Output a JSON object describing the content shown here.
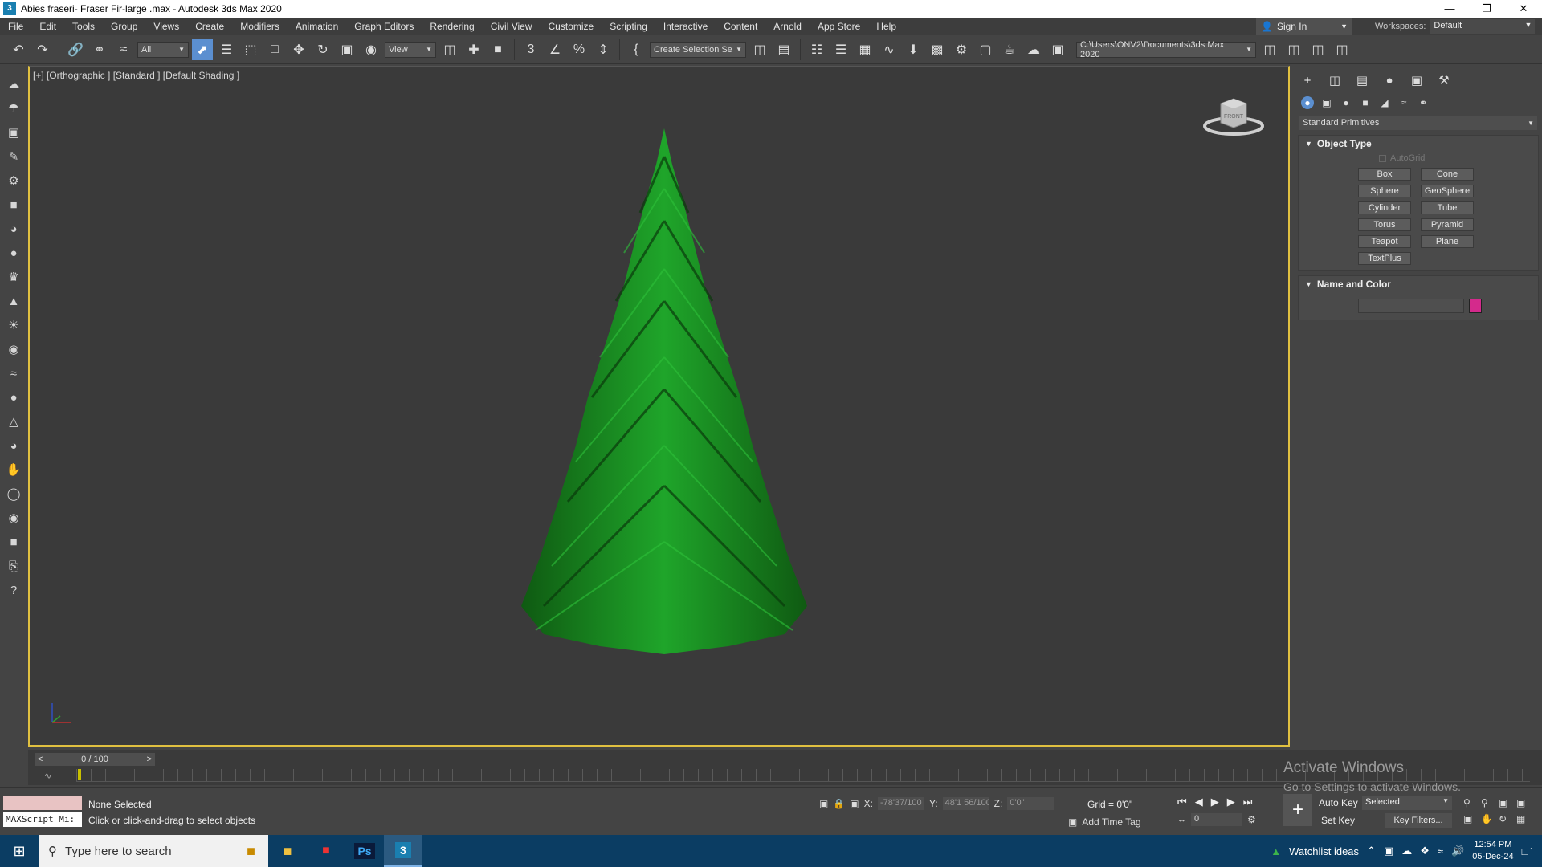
{
  "window": {
    "title": "Abies fraseri- Fraser Fir-large .max - Autodesk 3ds Max 2020",
    "app_badge": "3",
    "controls": [
      "—",
      "❐",
      "✕"
    ]
  },
  "menu": {
    "items": [
      "File",
      "Edit",
      "Tools",
      "Group",
      "Views",
      "Create",
      "Modifiers",
      "Animation",
      "Graph Editors",
      "Rendering",
      "Civil View",
      "Customize",
      "Scripting",
      "Interactive",
      "Content",
      "Arnold",
      "App Store",
      "Help"
    ],
    "sign_in": "Sign In",
    "workspaces_label": "Workspaces:",
    "workspaces_value": "Default"
  },
  "toolbar": {
    "selection_filter": "All",
    "ref_coord": "View",
    "named_selection": "Create Selection Se",
    "project_path": "C:\\Users\\ONV2\\Documents\\3ds Max 2020"
  },
  "viewport": {
    "label": "[+] [Orthographic ] [Standard ] [Default Shading ]",
    "viewcube_face": "FRONT"
  },
  "command_panel": {
    "category": "Standard Primitives",
    "object_type_header": "Object Type",
    "autogrid": "AutoGrid",
    "primitives": [
      "Box",
      "Cone",
      "Sphere",
      "GeoSphere",
      "Cylinder",
      "Tube",
      "Torus",
      "Pyramid",
      "Teapot",
      "Plane",
      "TextPlus"
    ],
    "name_color_header": "Name and Color",
    "object_color": "#d42a8c"
  },
  "timeline": {
    "frame_display": "0 / 100",
    "prev": "<",
    "next": ">"
  },
  "status": {
    "maxscript": "MAXScript Mi:",
    "selection": "None Selected",
    "prompt": "Click or click-and-drag to select objects",
    "x_label": "X:",
    "x_value": "-78'37/100",
    "y_label": "Y:",
    "y_value": "48'1 56/100",
    "z_label": "Z:",
    "z_value": "0'0\"",
    "grid": "Grid = 0'0\"",
    "add_time_tag": "Add Time Tag",
    "current_frame": "0",
    "auto_key": "Auto Key",
    "set_key": "Set Key",
    "key_mode_dd": "Selected",
    "key_filters": "Key Filters..."
  },
  "watermark": {
    "line1": "Activate Windows",
    "line2": "Go to Settings to activate Windows."
  },
  "taskbar": {
    "search_placeholder": "Type here to search",
    "apps": [
      "Ps",
      "3"
    ],
    "news": "Watchlist ideas",
    "time": "12:54 PM",
    "date": "05-Dec-24",
    "notifications": "1"
  }
}
